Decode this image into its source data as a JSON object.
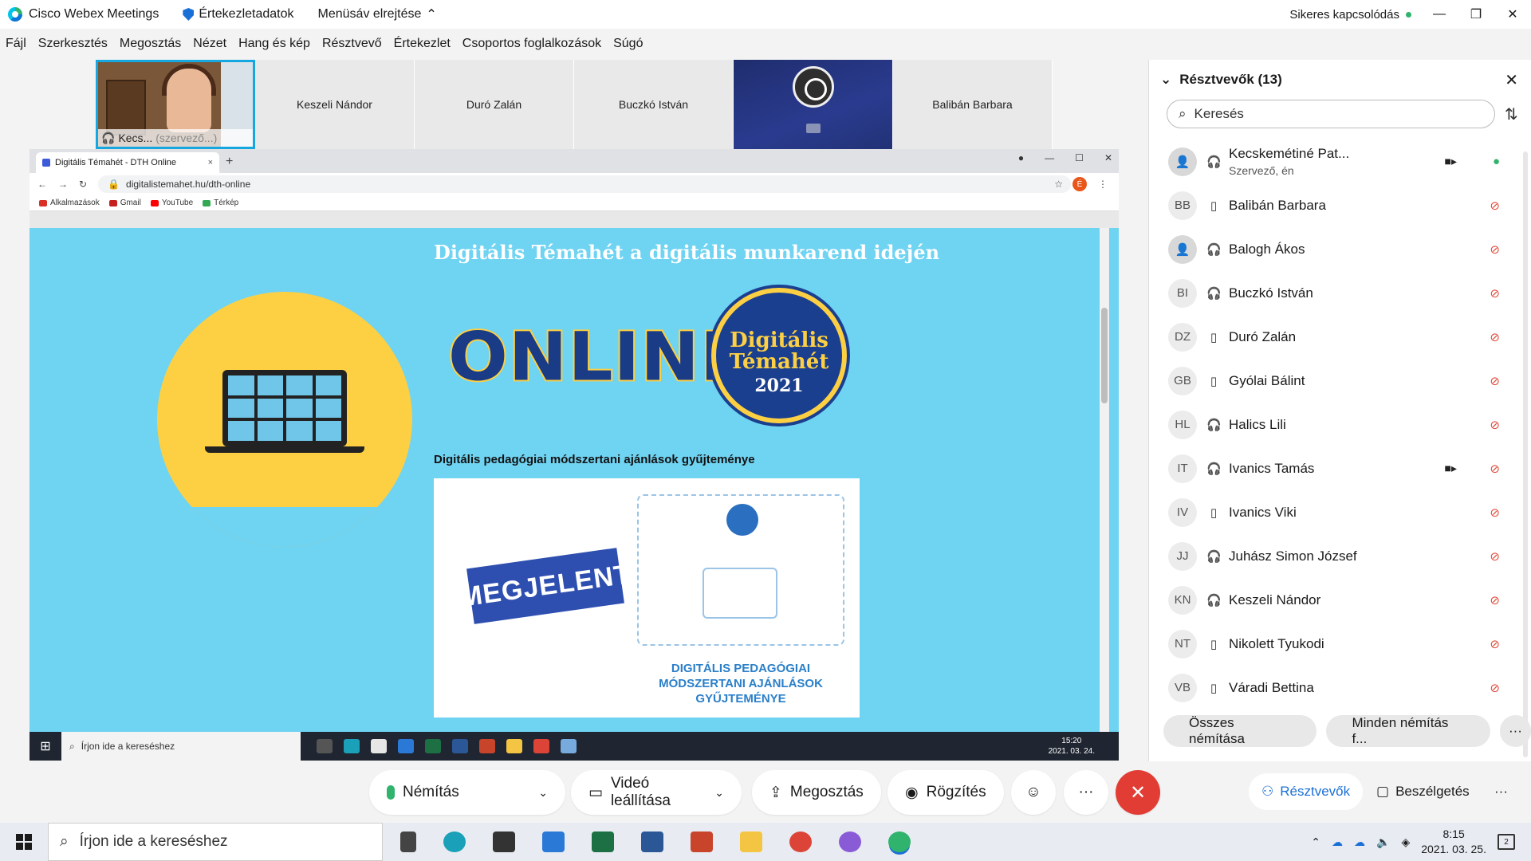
{
  "titlebar": {
    "app_name": "Cisco Webex Meetings",
    "meeting_info": "Értekezletadatok",
    "hide_menu": "Menüsáv elrejtése",
    "status": "Sikeres kapcsolódás",
    "minimize": "—",
    "restore": "❐",
    "close": "✕"
  },
  "menubar": [
    "Fájl",
    "Szerkesztés",
    "Megosztás",
    "Nézet",
    "Hang és kép",
    "Résztvevő",
    "Értekezlet",
    "Csoportos foglalkozások",
    "Súgó"
  ],
  "video_strip": {
    "self_label": "Kecs...",
    "self_role": "(szervező...)",
    "tiles": [
      "Keszeli Nándor",
      "Duró Zalán",
      "Buczkó István",
      "",
      "Balibán Barbara"
    ]
  },
  "browser": {
    "tab_title": "Digitális Témahét - DTH Online",
    "tab_close": "×",
    "new_tab": "+",
    "url": "digitalistemahet.hu/dth-online",
    "profile_initial": "É",
    "bookmarks": [
      {
        "label": "Alkalmazások",
        "color": "#d93025"
      },
      {
        "label": "Gmail",
        "color": "#c5221f"
      },
      {
        "label": "YouTube",
        "color": "#ff0000"
      },
      {
        "label": "Térkép",
        "color": "#34a853"
      }
    ]
  },
  "web_page": {
    "title": "Digitális Témahét a digitális munkarend idején",
    "online_word": "ONLINE",
    "badge_line1": "Digitális",
    "badge_line2": "Témahét",
    "badge_year": "2021",
    "subtitle": "Digitális pedagógiai módszertani ajánlások gyűjteménye",
    "stamp": "MEGJELENT",
    "book_caption_1": "DIGITÁLIS PEDAGÓGIAI",
    "book_caption_2": "MÓDSZERTANI AJÁNLÁSOK",
    "book_caption_3": "GYŰJTEMÉNYE"
  },
  "inner_taskbar": {
    "search_placeholder": "Írjon ide a kereséshez",
    "time": "15:20",
    "date": "2021. 03. 24."
  },
  "participants_panel": {
    "title": "Résztvevők (13)",
    "search_placeholder": "Keresés",
    "participants": [
      {
        "initials": "",
        "name": "Kecskemétiné Pat...",
        "role": "Szervező, én",
        "device": "headset",
        "video": true,
        "mic": "on"
      },
      {
        "initials": "BB",
        "name": "Balibán Barbara",
        "role": "",
        "device": "phone",
        "video": false,
        "mic": "off"
      },
      {
        "initials": "",
        "name": "Balogh Ákos",
        "role": "",
        "device": "headset",
        "video": false,
        "mic": "off"
      },
      {
        "initials": "BI",
        "name": "Buczkó István",
        "role": "",
        "device": "headset",
        "video": false,
        "mic": "off"
      },
      {
        "initials": "DZ",
        "name": "Duró Zalán",
        "role": "",
        "device": "phone",
        "video": false,
        "mic": "off"
      },
      {
        "initials": "GB",
        "name": "Gyólai Bálint",
        "role": "",
        "device": "phone",
        "video": false,
        "mic": "off"
      },
      {
        "initials": "HL",
        "name": "Halics Lili",
        "role": "",
        "device": "headset",
        "video": false,
        "mic": "off"
      },
      {
        "initials": "IT",
        "name": "Ivanics Tamás",
        "role": "",
        "device": "headset",
        "video": true,
        "mic": "off"
      },
      {
        "initials": "IV",
        "name": "Ivanics Viki",
        "role": "",
        "device": "phone",
        "video": false,
        "mic": "off"
      },
      {
        "initials": "JJ",
        "name": "Juhász Simon József",
        "role": "",
        "device": "headset",
        "video": false,
        "mic": "off"
      },
      {
        "initials": "KN",
        "name": "Keszeli Nándor",
        "role": "",
        "device": "headset",
        "video": false,
        "mic": "off"
      },
      {
        "initials": "NT",
        "name": "Nikolett Tyukodi",
        "role": "",
        "device": "phone",
        "video": false,
        "mic": "off"
      },
      {
        "initials": "VB",
        "name": "Váradi Bettina",
        "role": "",
        "device": "phone",
        "video": false,
        "mic": "off"
      }
    ],
    "mute_all": "Összes némítása",
    "unmute_all": "Minden némítás f...",
    "more": "···"
  },
  "controls": {
    "mute": "Némítás",
    "stop_video": "Videó leállítása",
    "share": "Megosztás",
    "record": "Rögzítés",
    "more": "···",
    "participants": "Résztvevők",
    "chat": "Beszélgetés",
    "end": "✕"
  },
  "taskbar": {
    "search_placeholder": "Írjon ide a kereséshez",
    "time": "8:15",
    "date": "2021. 03. 25.",
    "notifications": "2"
  }
}
